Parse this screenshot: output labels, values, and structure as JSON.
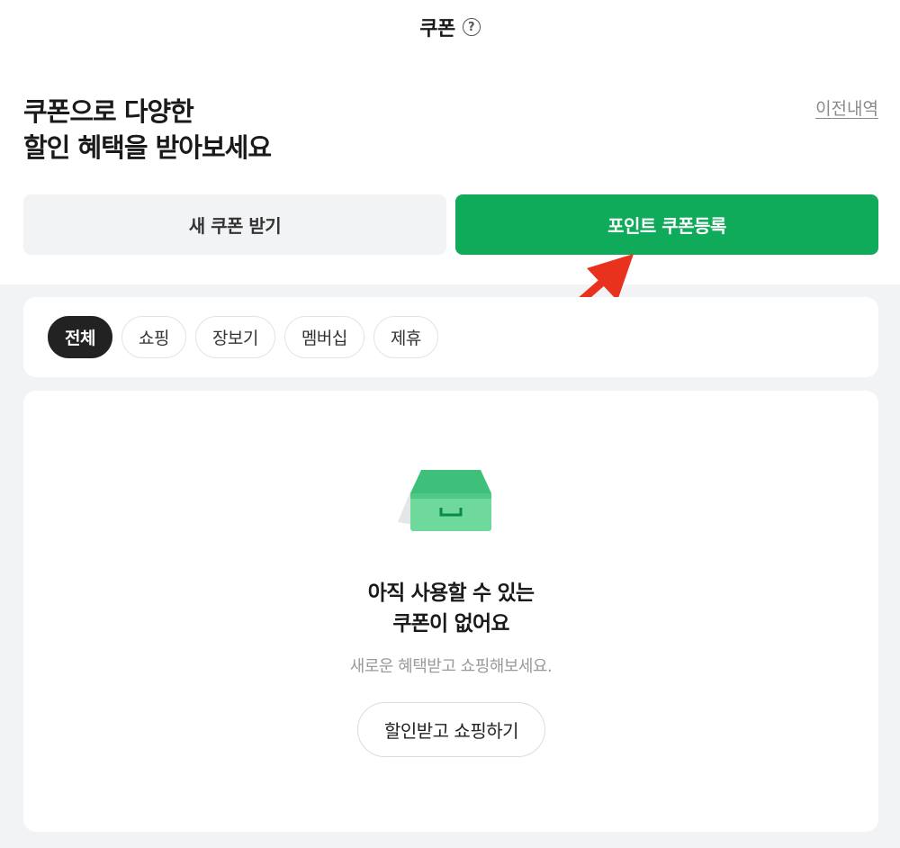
{
  "header": {
    "title": "쿠폰",
    "help_icon": "question-circle-icon"
  },
  "headline": {
    "line1": "쿠폰으로 다양한",
    "line2": "할인 혜택을 받아보세요"
  },
  "history_link": "이전내역",
  "actions": {
    "new_coupon": "새 쿠폰 받기",
    "register_point_coupon": "포인트 쿠폰등록",
    "register_color": "#0faa5a"
  },
  "annotation": {
    "arrow_color": "#e8321e"
  },
  "tabs": [
    {
      "label": "전체",
      "active": true
    },
    {
      "label": "쇼핑",
      "active": false
    },
    {
      "label": "장보기",
      "active": false
    },
    {
      "label": "멤버십",
      "active": false
    },
    {
      "label": "제휴",
      "active": false
    }
  ],
  "empty_state": {
    "icon": "empty-inbox-icon",
    "title_line1": "아직 사용할 수 있는",
    "title_line2": "쿠폰이 없어요",
    "subtitle": "새로운 혜택받고 쇼핑해보세요.",
    "button": "할인받고 쇼핑하기"
  }
}
